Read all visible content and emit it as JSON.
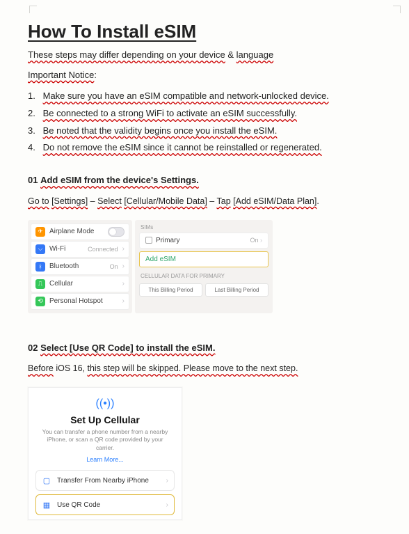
{
  "title": "How To Install eSIM",
  "intro": {
    "a": "These steps may differ depending on your device",
    "amp": " & ",
    "b": "language"
  },
  "notice": {
    "label": "Important Notice",
    "colon": ":"
  },
  "rules": [
    {
      "n": "1.",
      "t": "Make sure you have an eSIM compatible and network-unlocked device."
    },
    {
      "n": "2.",
      "t": "Be connected to a strong WiFi to activate an eSIM successfully."
    },
    {
      "n": "3.",
      "t": "Be noted that the validity begins once you install the eSIM."
    },
    {
      "n": "4.",
      "t": "Do not remove the eSIM since it cannot be reinstalled or regenerated."
    }
  ],
  "step1": {
    "num": "01",
    "title": "Add eSIM from the device's Settings.",
    "sub": {
      "a": "Go to",
      "b": "[Settings]",
      "dash1": " – ",
      "c": "Select",
      "d": "[Cellular/Mobile Data]",
      "dash2": " – ",
      "e": "Tap",
      "f": "[Add eSIM/Data Plan]",
      "dot": "."
    },
    "panelA": {
      "airplane": "Airplane Mode",
      "wifi": "Wi-Fi",
      "wifi_meta": "Connected",
      "bt": "Bluetooth",
      "bt_meta": "On",
      "cellular": "Cellular",
      "hotspot": "Personal Hotspot"
    },
    "panelB": {
      "sims": "SIMs",
      "primary": "Primary",
      "primary_meta": "On",
      "add": "Add eSIM",
      "cell_hdr": "CELLULAR DATA FOR PRIMARY",
      "bill1": "This Billing Period",
      "bill2": "Last Billing Period"
    }
  },
  "step2": {
    "num": "02",
    "title": "Select [Use QR Code] to install the eSIM.",
    "sub": {
      "a": "Before",
      "b": " iOS 16, ",
      "c": "this step will be skipped. Please move to the next step."
    },
    "card": {
      "heading": "Set Up Cellular",
      "desc": "You can transfer a phone number from a nearby iPhone, or scan a QR code provided by your carrier.",
      "learn": "Learn More...",
      "opt1": "Transfer From Nearby iPhone",
      "opt2": "Use QR Code"
    }
  }
}
